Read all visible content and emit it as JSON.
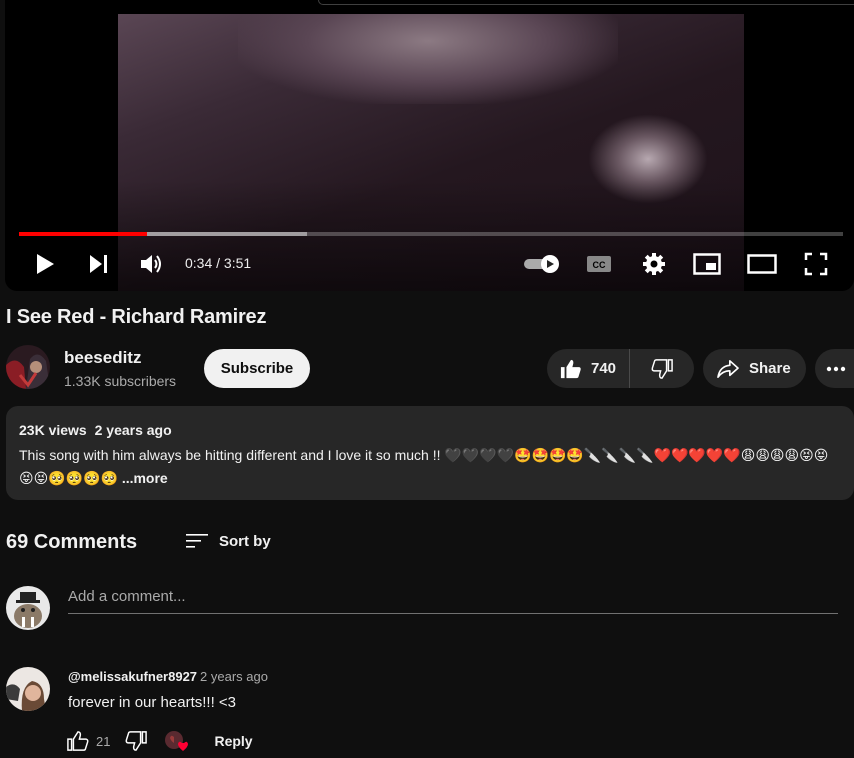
{
  "player": {
    "time_display": "0:34 / 3:51",
    "progress_played": 0.155,
    "progress_buffered": 0.35,
    "accent_color": "#ff0000"
  },
  "video": {
    "title": "I See Red - Richard Ramirez"
  },
  "channel": {
    "name": "beeseditz",
    "subscribers": "1.33K subscribers",
    "subscribe_label": "Subscribe"
  },
  "actions": {
    "like_count": "740",
    "share_label": "Share"
  },
  "description": {
    "views": "23K views",
    "age": "2 years ago",
    "text": "This song with him always be hitting different and I love it so much !! 🖤🖤🖤🖤🤩🤩🤩🤩🔪🔪🔪🔪❤️❤️❤️❤️❤️😩😩😩😩😝😝😝😝🥺🥺🥺🥺",
    "more_label": "...more"
  },
  "comments": {
    "count_label": "69 Comments",
    "sort_label": "Sort by",
    "add_placeholder": "Add a comment...",
    "items": [
      {
        "author": "@melissakufner8927",
        "time": "2 years ago",
        "text": "forever in our hearts!!! <3",
        "likes": "21",
        "reply_label": "Reply"
      }
    ]
  }
}
